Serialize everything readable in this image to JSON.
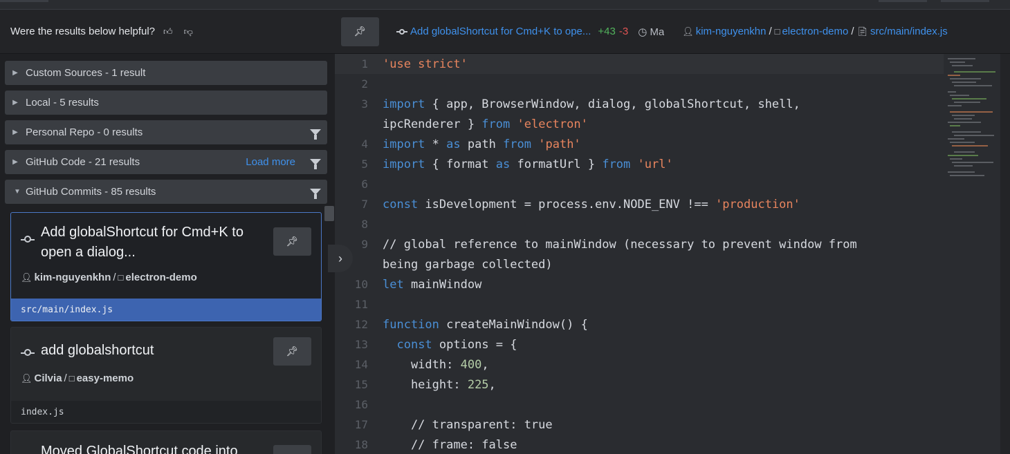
{
  "feedback": {
    "question": "Were the results below helpful?",
    "up_icon": "thumbs-up-icon",
    "down_icon": "thumbs-down-icon"
  },
  "sections": [
    {
      "label": "Custom Sources - 1 result",
      "expanded": false,
      "filter": false,
      "load_more": ""
    },
    {
      "label": "Local - 5 results",
      "expanded": false,
      "filter": false,
      "load_more": ""
    },
    {
      "label": "Personal Repo - 0 results",
      "expanded": false,
      "filter": true,
      "load_more": ""
    },
    {
      "label": "GitHub Code - 21 results",
      "expanded": false,
      "filter": true,
      "load_more": "Load more"
    },
    {
      "label": "GitHub Commits - 85 results",
      "expanded": true,
      "filter": true,
      "load_more": ""
    }
  ],
  "results": [
    {
      "title": "Add globalShortcut for Cmd+K to open a dialog...",
      "user": "kim-nguyenkhn",
      "repo": "electron-demo",
      "file": "src/main/index.js",
      "active": true
    },
    {
      "title": "add globalshortcut",
      "user": "Cilvia",
      "repo": "easy-memo",
      "file": "index.js",
      "active": false
    },
    {
      "title": "Moved GlobalShortcut code into",
      "user": "",
      "repo": "",
      "file": "",
      "active": false
    }
  ],
  "header": {
    "commit_title": "Add globalShortcut for Cmd+K to ope...",
    "additions": "+43",
    "deletions": "-3",
    "date": "Ma",
    "user": "kim-nguyenkhn",
    "repo": "electron-demo",
    "file": "src/main/index.js",
    "separator": "/"
  },
  "code": {
    "lines": [
      {
        "n": "1",
        "text": "'use strict'"
      },
      {
        "n": "2",
        "text": ""
      },
      {
        "n": "3",
        "text": "import { app, BrowserWindow, dialog, globalShortcut, shell,"
      },
      {
        "n": "",
        "text": "ipcRenderer } from 'electron'"
      },
      {
        "n": "4",
        "text": "import * as path from 'path'"
      },
      {
        "n": "5",
        "text": "import { format as formatUrl } from 'url'"
      },
      {
        "n": "6",
        "text": ""
      },
      {
        "n": "7",
        "text": "const isDevelopment = process.env.NODE_ENV !== 'production'"
      },
      {
        "n": "8",
        "text": ""
      },
      {
        "n": "9",
        "text": "// global reference to mainWindow (necessary to prevent window from"
      },
      {
        "n": "",
        "text": "being garbage collected)"
      },
      {
        "n": "10",
        "text": "let mainWindow"
      },
      {
        "n": "11",
        "text": ""
      },
      {
        "n": "12",
        "text": "function createMainWindow() {"
      },
      {
        "n": "13",
        "text": "  const options = {"
      },
      {
        "n": "14",
        "text": "    width: 400,"
      },
      {
        "n": "15",
        "text": "    height: 225,"
      },
      {
        "n": "16",
        "text": ""
      },
      {
        "n": "17",
        "text": "    // transparent: true"
      },
      {
        "n": "18",
        "text": "    // frame: false"
      }
    ]
  },
  "colors": {
    "link": "#3f91ec",
    "additions": "#52b35c",
    "deletions": "#e05454",
    "keyword": "#4a8fd6",
    "string": "#e8855e",
    "comment": "#6f9e56",
    "selected_file": "#3d64b0"
  }
}
